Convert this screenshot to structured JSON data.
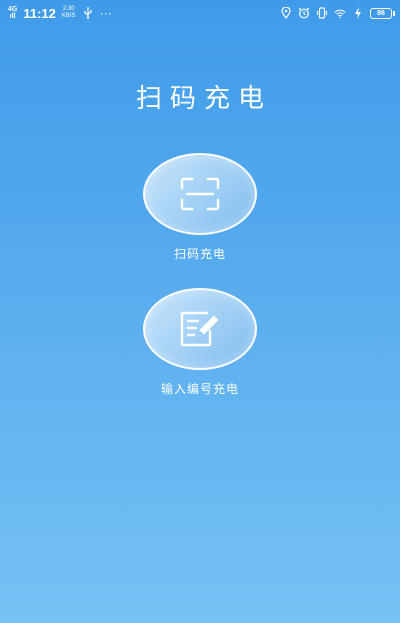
{
  "status_bar": {
    "network": "4G",
    "signal_bars": "ıll",
    "time": "11:12",
    "speed_value": "2.30",
    "speed_unit": "KB/S",
    "usb_icon": "usb-icon",
    "dots": "···",
    "battery_level": "86"
  },
  "page": {
    "title": "扫码充电"
  },
  "actions": {
    "scan": {
      "label": "扫码充电",
      "icon": "scan-frame-icon"
    },
    "input": {
      "label": "输入编号充电",
      "icon": "edit-note-icon"
    }
  },
  "colors": {
    "background_top": "#3f9be9",
    "background_bottom": "#76c2f4",
    "circle_fill": "#a7d3f6",
    "text": "#ffffff"
  }
}
